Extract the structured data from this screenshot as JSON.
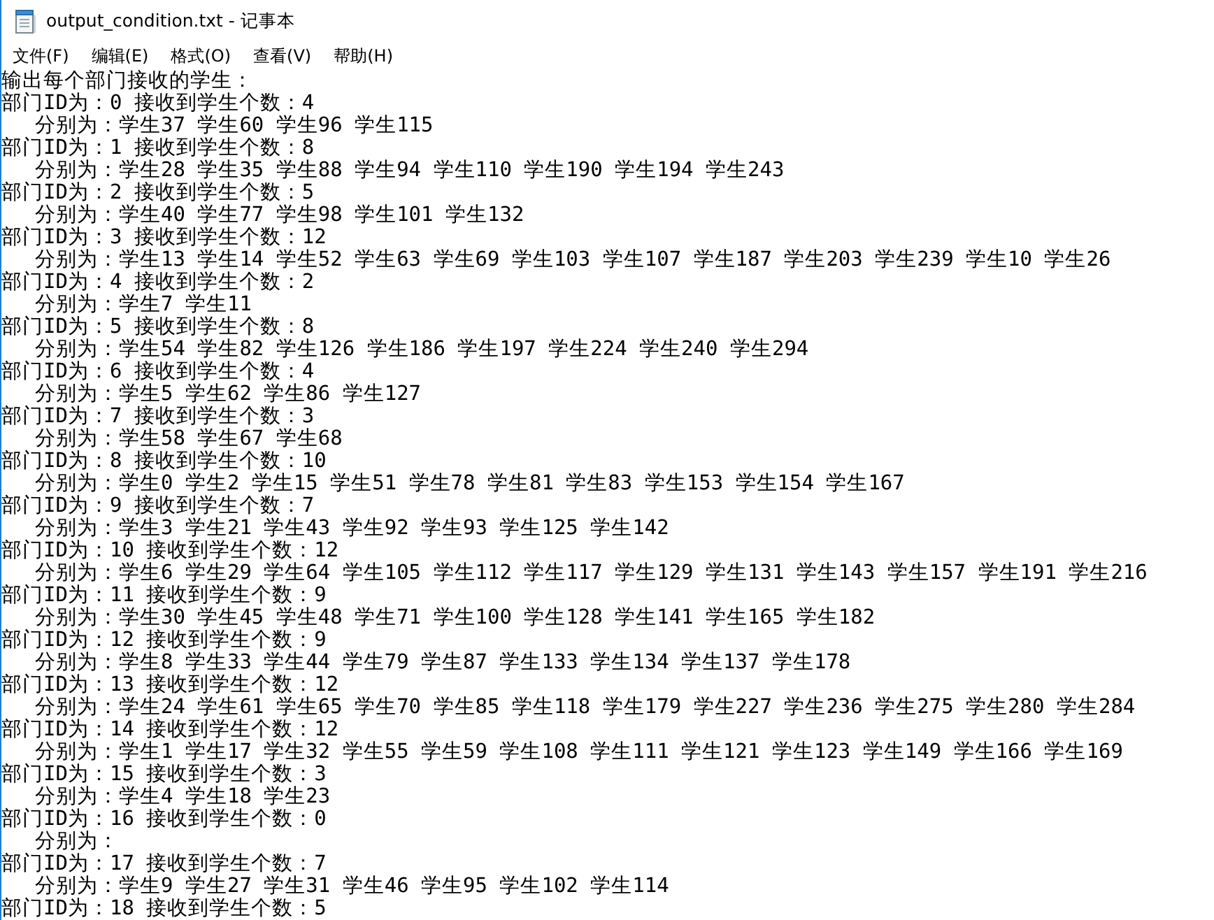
{
  "window": {
    "title": "output_condition.txt - 记事本"
  },
  "menu": [
    {
      "label": "文件(F)"
    },
    {
      "label": "编辑(E)"
    },
    {
      "label": "格式(O)"
    },
    {
      "label": "查看(V)"
    },
    {
      "label": "帮助(H)"
    }
  ],
  "document": {
    "lines": [
      {
        "kind": "heading",
        "text": "输出每个部门接收的学生："
      },
      {
        "kind": "department",
        "text": "部门ID为：0 接收到学生个数：4"
      },
      {
        "kind": "students",
        "text": "分别为：学生37 学生60 学生96 学生115"
      },
      {
        "kind": "department",
        "text": "部门ID为：1 接收到学生个数：8"
      },
      {
        "kind": "students",
        "text": "分别为：学生28 学生35 学生88 学生94 学生110 学生190 学生194 学生243"
      },
      {
        "kind": "department",
        "text": "部门ID为：2 接收到学生个数：5"
      },
      {
        "kind": "students",
        "text": "分别为：学生40 学生77 学生98 学生101 学生132"
      },
      {
        "kind": "department",
        "text": "部门ID为：3 接收到学生个数：12"
      },
      {
        "kind": "students",
        "text": "分别为：学生13 学生14 学生52 学生63 学生69 学生103 学生107 学生187 学生203 学生239 学生10 学生26"
      },
      {
        "kind": "department",
        "text": "部门ID为：4 接收到学生个数：2"
      },
      {
        "kind": "students",
        "text": "分别为：学生7 学生11"
      },
      {
        "kind": "department",
        "text": "部门ID为：5 接收到学生个数：8"
      },
      {
        "kind": "students",
        "text": "分别为：学生54 学生82 学生126 学生186 学生197 学生224 学生240 学生294"
      },
      {
        "kind": "department",
        "text": "部门ID为：6 接收到学生个数：4"
      },
      {
        "kind": "students",
        "text": "分别为：学生5 学生62 学生86 学生127"
      },
      {
        "kind": "department",
        "text": "部门ID为：7 接收到学生个数：3"
      },
      {
        "kind": "students",
        "text": "分别为：学生58 学生67 学生68"
      },
      {
        "kind": "department",
        "text": "部门ID为：8 接收到学生个数：10"
      },
      {
        "kind": "students",
        "text": "分别为：学生0 学生2 学生15 学生51 学生78 学生81 学生83 学生153 学生154 学生167"
      },
      {
        "kind": "department",
        "text": "部门ID为：9 接收到学生个数：7"
      },
      {
        "kind": "students",
        "text": "分别为：学生3 学生21 学生43 学生92 学生93 学生125 学生142"
      },
      {
        "kind": "department",
        "text": "部门ID为：10 接收到学生个数：12"
      },
      {
        "kind": "students",
        "text": "分别为：学生6 学生29 学生64 学生105 学生112 学生117 学生129 学生131 学生143 学生157 学生191 学生216"
      },
      {
        "kind": "department",
        "text": "部门ID为：11 接收到学生个数：9"
      },
      {
        "kind": "students",
        "text": "分别为：学生30 学生45 学生48 学生71 学生100 学生128 学生141 学生165 学生182"
      },
      {
        "kind": "department",
        "text": "部门ID为：12 接收到学生个数：9"
      },
      {
        "kind": "students",
        "text": "分别为：学生8 学生33 学生44 学生79 学生87 学生133 学生134 学生137 学生178"
      },
      {
        "kind": "department",
        "text": "部门ID为：13 接收到学生个数：12"
      },
      {
        "kind": "students",
        "text": "分别为：学生24 学生61 学生65 学生70 学生85 学生118 学生179 学生227 学生236 学生275 学生280 学生284"
      },
      {
        "kind": "department",
        "text": "部门ID为：14 接收到学生个数：12"
      },
      {
        "kind": "students",
        "text": "分别为：学生1 学生17 学生32 学生55 学生59 学生108 学生111 学生121 学生123 学生149 学生166 学生169"
      },
      {
        "kind": "department",
        "text": "部门ID为：15 接收到学生个数：3"
      },
      {
        "kind": "students",
        "text": "分别为：学生4 学生18 学生23"
      },
      {
        "kind": "department",
        "text": "部门ID为：16 接收到学生个数：0"
      },
      {
        "kind": "students",
        "text": "分别为："
      },
      {
        "kind": "department",
        "text": "部门ID为：17 接收到学生个数：7"
      },
      {
        "kind": "students",
        "text": "分别为：学生9 学生27 学生31 学生46 学生95 学生102 学生114"
      },
      {
        "kind": "department",
        "text": "部门ID为：18 接收到学生个数：5"
      }
    ]
  }
}
